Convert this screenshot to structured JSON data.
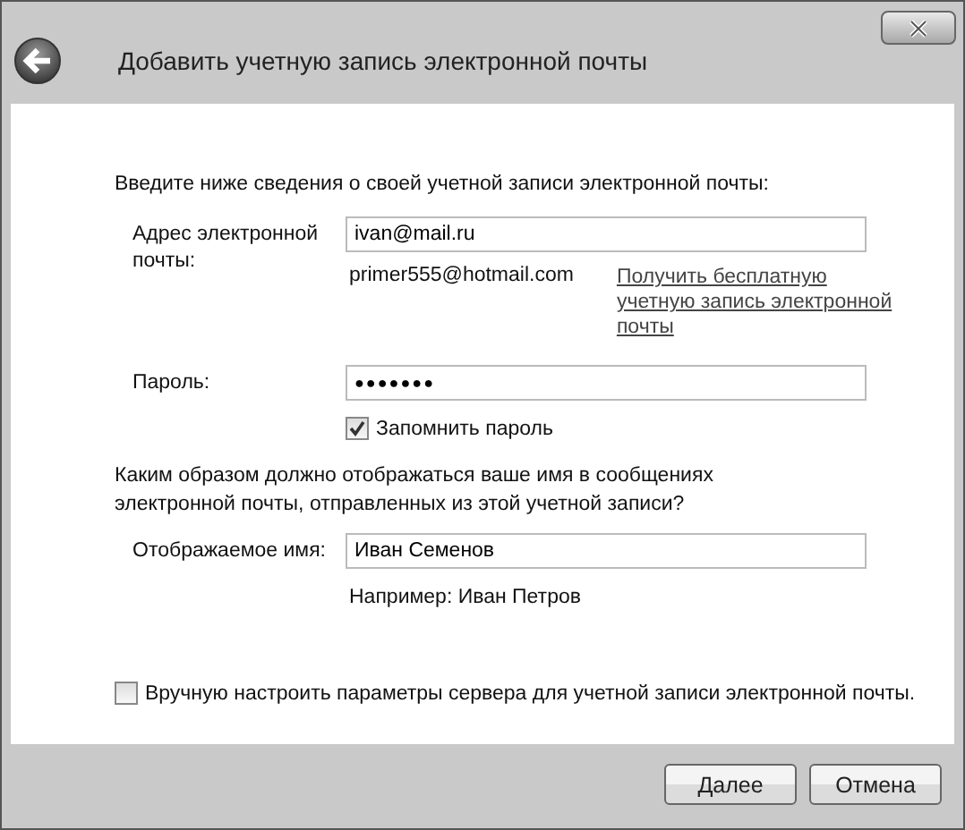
{
  "window": {
    "title": "Добавить учетную запись электронной почты"
  },
  "intro": "Введите ниже сведения о своей учетной записи электронной почты:",
  "email": {
    "label": "Адрес электронной почты:",
    "value": "ivan@mail.ru",
    "example": "primer555@hotmail.com",
    "link": "Получить бесплатную учетную запись электронной почты"
  },
  "password": {
    "label": "Пароль:",
    "value": "●●●●●●●",
    "remember": {
      "label": "Запомнить пароль",
      "checked": true
    }
  },
  "question": "Каким образом должно отображаться ваше имя в сообщениях электронной почты, отправленных из этой учетной записи?",
  "display_name": {
    "label": "Отображаемое имя:",
    "value": "Иван Семенов",
    "example": "Например: Иван Петров"
  },
  "manual": {
    "label": "Вручную настроить параметры сервера для учетной записи электронной почты.",
    "checked": false
  },
  "buttons": [
    {
      "label": "Далее"
    },
    {
      "label": "Отмена"
    }
  ]
}
